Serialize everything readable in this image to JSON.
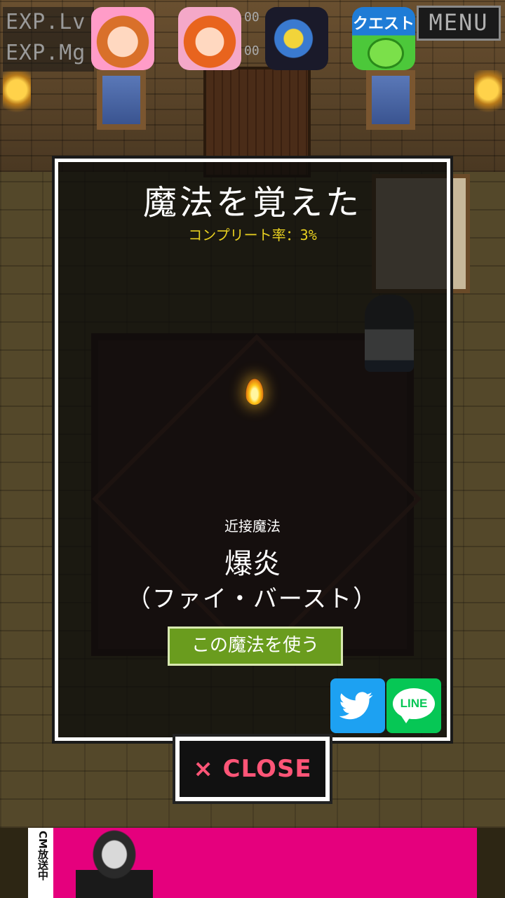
{
  "hud": {
    "exp_lv_label": "EXP.Lv",
    "exp_mg_label": "EXP.Mg",
    "digits_top": "00",
    "digits_bottom": "00",
    "menu_label": "MENU"
  },
  "ad_icons": [
    {
      "name": "idol-game-icon-1"
    },
    {
      "name": "idol-game-icon-2"
    },
    {
      "name": "puzzle-dragon-icon"
    },
    {
      "name": "quest-puyo-icon",
      "label": "クエスト"
    }
  ],
  "modal": {
    "title": "魔法を覚えた",
    "complete_rate": "コンプリート率：3%",
    "magic_type": "近接魔法",
    "magic_name": "爆炎",
    "magic_reading": "（ファイ・バースト）",
    "use_button": "この魔法を使う",
    "share_line_label": "LINE"
  },
  "close_button": "× CLOSE",
  "ad_banner": {
    "side_text": "CM放送中"
  },
  "colors": {
    "complete_rate": "#e8d020",
    "use_button": "#6a9c1e",
    "close_text": "#ff5577",
    "twitter": "#1da1f2",
    "line": "#06c755",
    "ad_banner": "#e5007d"
  }
}
